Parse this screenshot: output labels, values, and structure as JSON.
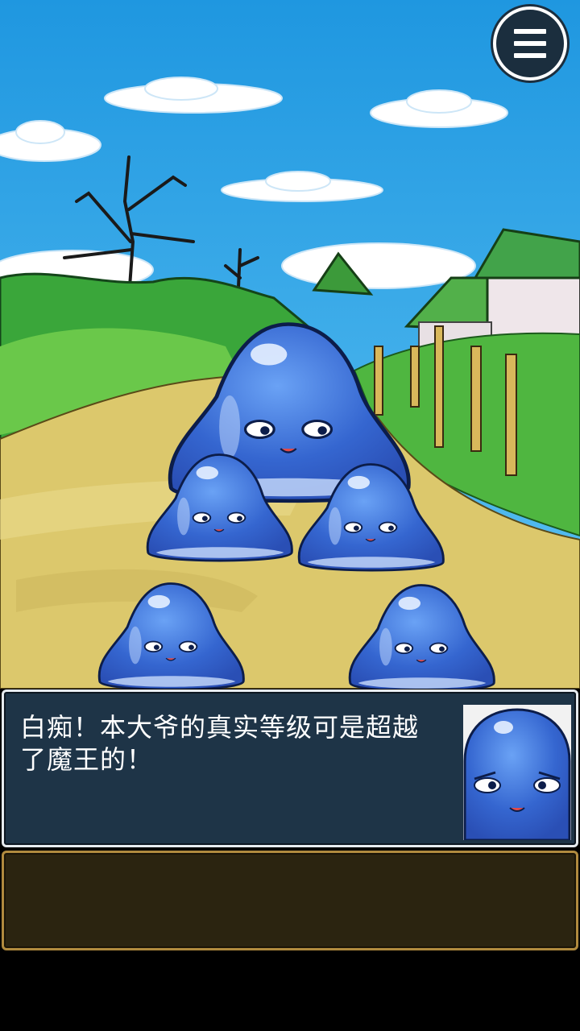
{
  "menu": {
    "icon": "hamburger-menu-icon"
  },
  "dialog": {
    "text": "白痴！本大爷的真实等级可是超越了魔王的！",
    "speaker_portrait": "slime-boss-portrait"
  },
  "scene": {
    "background": "village-path-landscape",
    "characters": [
      "slime-boss",
      "slime-minion",
      "slime-minion",
      "slime-minion",
      "slime-minion"
    ]
  },
  "colors": {
    "sky": "#1e9be0",
    "slime": "#3f6fd8",
    "dialog_bg": "#1e3447",
    "choice_bg": "#2b2410",
    "choice_border": "#b08a3e"
  }
}
